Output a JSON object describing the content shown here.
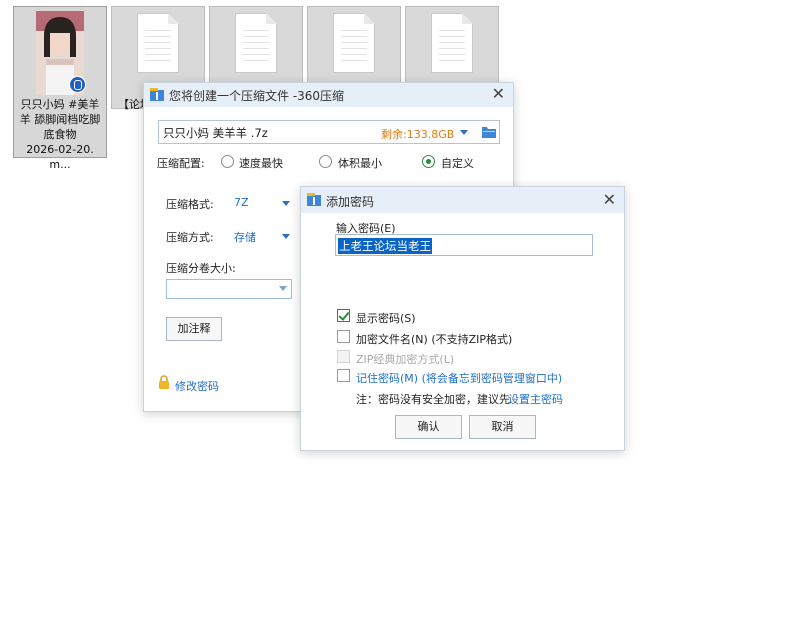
{
  "desktop": {
    "files": [
      {
        "name_lines": [
          "只只小妈 #美羊",
          "羊  舔脚闻档吃脚",
          "底食物",
          "2026-02-20.m..."
        ],
        "type": "video"
      },
      {
        "name_lines": [
          "【论坛"
        ],
        "type": "document"
      },
      {
        "name_lines": [
          ""
        ],
        "type": "document"
      },
      {
        "name_lines": [
          ""
        ],
        "type": "document"
      },
      {
        "name_lines": [
          ""
        ],
        "type": "document"
      }
    ]
  },
  "compress_dialog": {
    "title": "您将创建一个压缩文件 -360压缩",
    "filename": "只只小妈 美羊羊 .7z",
    "free_space": "剩余:133.8GB",
    "config_label": "压缩配置:",
    "options": [
      "速度最快",
      "体积最小",
      "自定义"
    ],
    "selected_option": "自定义",
    "format_label": "压缩格式:",
    "format_value": "7Z",
    "method_label": "压缩方式:",
    "method_value": "存储",
    "split_label": "压缩分卷大小:",
    "split_value": "",
    "comment_button": "加注释",
    "change_password_link": "修改密码"
  },
  "password_dialog": {
    "title": "添加密码",
    "input_label": "输入密码(E)",
    "password_value": "上老王论坛当老王",
    "show_password": {
      "label": "显示密码(S)",
      "checked": true
    },
    "encrypt_filename": {
      "label": "加密文件名(N)",
      "note": "(不支持ZIP格式)",
      "checked": false
    },
    "zip_classic": {
      "label": "ZIP经典加密方式(L)",
      "enabled": false
    },
    "remember_password": {
      "label": "记住密码(M)",
      "note": "(将会备忘到密码管理窗口中)",
      "checked": false
    },
    "notice_prefix": "注：密码没有安全加密，建议先",
    "notice_link": "设置主密码",
    "ok_button": "确认",
    "cancel_button": "取消"
  },
  "colors": {
    "accent_blue": "#1f6fc7",
    "free_space_orange": "#e07b10",
    "check_green": "#2b8a3e",
    "titlebar_bg": "#e6eef7"
  }
}
